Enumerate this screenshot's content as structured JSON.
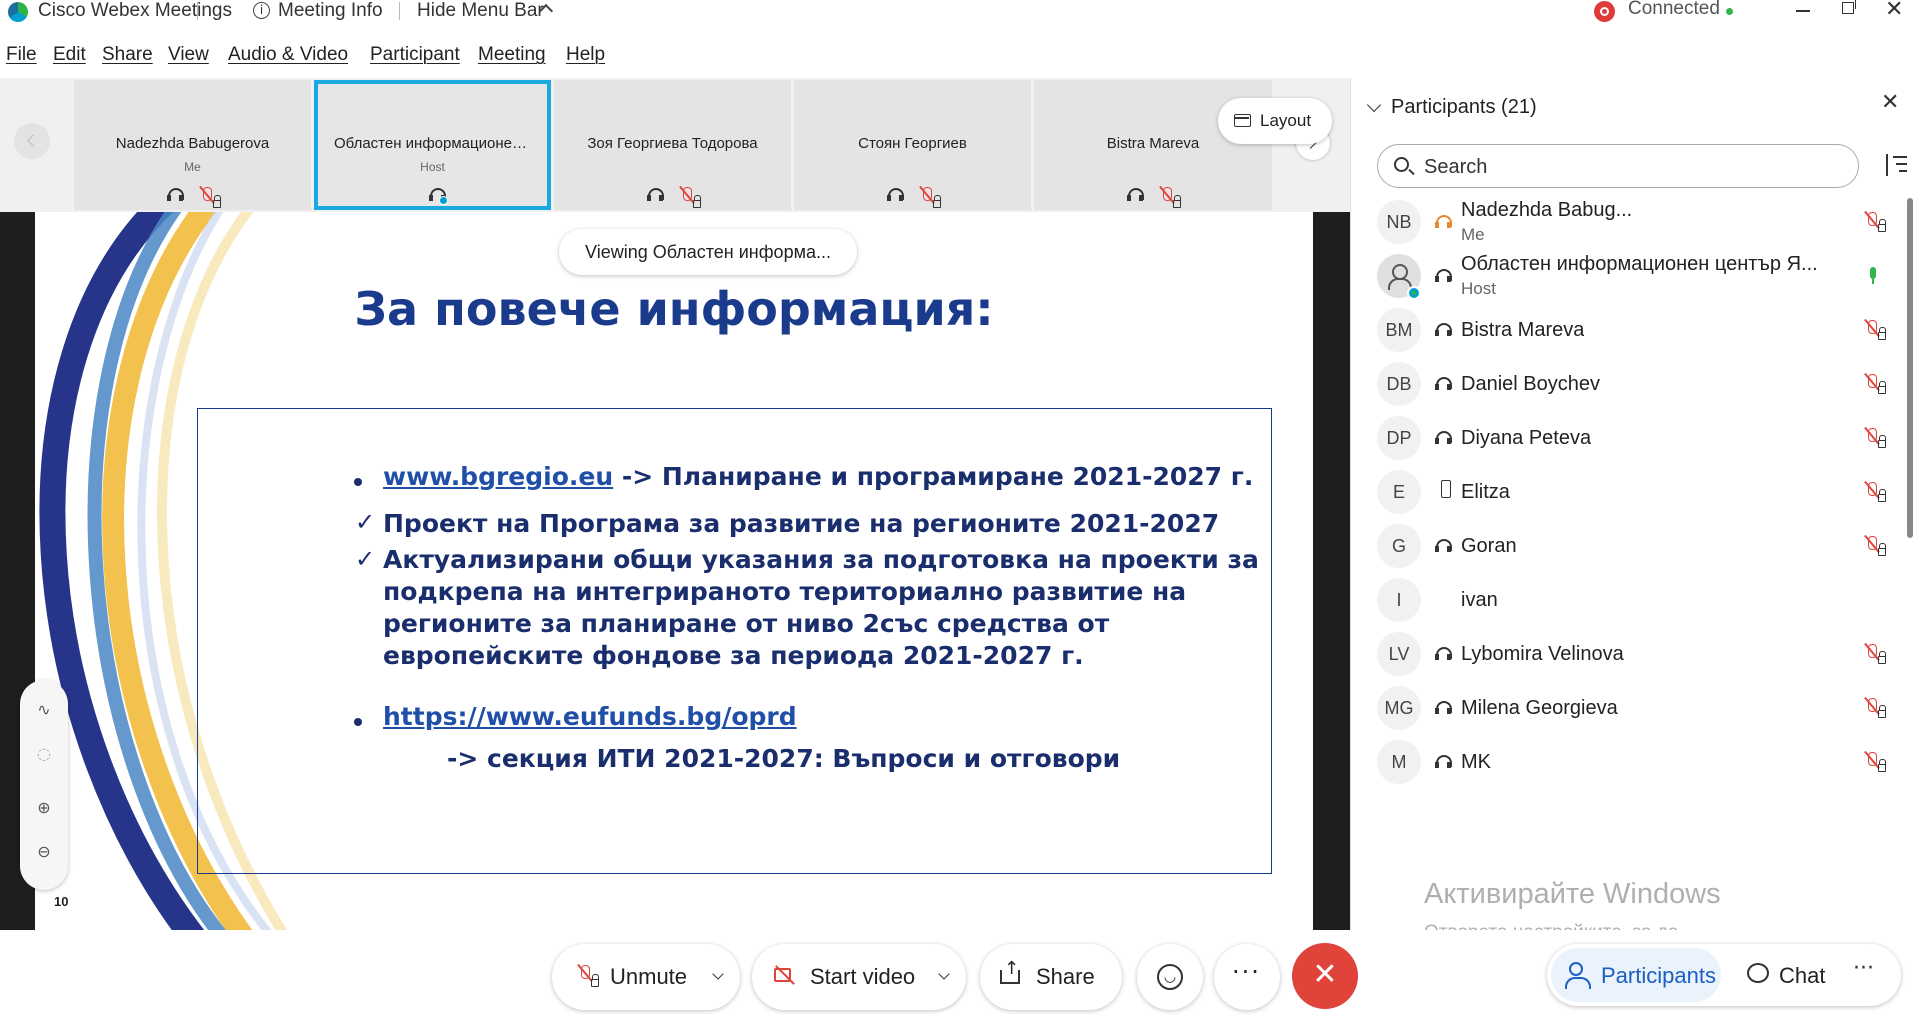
{
  "titlebar": {
    "app_name": "Cisco Webex Meetings",
    "meeting_info": "Meeting Info",
    "hide_menu_bar": "Hide Menu Bar",
    "connection_status": "Connected"
  },
  "menu": [
    "File",
    "Edit",
    "Share",
    "View",
    "Audio & Video",
    "Participant",
    "Meeting",
    "Help"
  ],
  "filmstrip": {
    "tiles": [
      {
        "name": "Nadezhda Babugerova",
        "role": "Me"
      },
      {
        "name": "Областен информационен...",
        "role": "Host"
      },
      {
        "name": "Зоя Георгиева Тодорова",
        "role": ""
      },
      {
        "name": "Стоян Георгиев",
        "role": ""
      },
      {
        "name": "Bistra Mareva",
        "role": ""
      }
    ],
    "layout_label": "Layout"
  },
  "share": {
    "viewing_label": "Viewing Областен информа...",
    "slide": {
      "title": "За повече информация:",
      "link1": "www.bgregio.eu",
      "link1_after": " -> Планиране и програмиране 2021-2027 г.",
      "check1": "Проект на Програма за развитие на регионите 2021-2027",
      "check2_lines": [
        "Актуализирани общи указания за подготовка на проекти за",
        "подкрепа на интегрираното териториално развитие на",
        "регионите за планиране от ниво 2със средства от",
        "европейските фондове за периода 2021-2027 г."
      ],
      "link2": "https://www.eufunds.bg/oprd",
      "link2_after": "-> секция ИТИ 2021-2027: Въпроси и отговори",
      "page_number": "10"
    }
  },
  "participants": {
    "title": "Participants (21)",
    "search_placeholder": "Search",
    "list": [
      {
        "initials": "NB",
        "name": "Nadezhda Babug...",
        "role": "Me"
      },
      {
        "initials": "",
        "name": "Областен информационен център Я...",
        "role": "Host"
      },
      {
        "initials": "BM",
        "name": "Bistra Mareva",
        "role": ""
      },
      {
        "initials": "DB",
        "name": "Daniel Boychev",
        "role": ""
      },
      {
        "initials": "DP",
        "name": "Diyana Peteva",
        "role": ""
      },
      {
        "initials": "E",
        "name": "Elitza",
        "role": ""
      },
      {
        "initials": "G",
        "name": "Goran",
        "role": ""
      },
      {
        "initials": "I",
        "name": "ivan",
        "role": ""
      },
      {
        "initials": "LV",
        "name": "Lybomira Velinova",
        "role": ""
      },
      {
        "initials": "MG",
        "name": "Milena Georgieva",
        "role": ""
      },
      {
        "initials": "M",
        "name": "MK",
        "role": ""
      }
    ]
  },
  "watermark": {
    "line1": "Активирайте Windows",
    "line2": "Отворете настройките, за да активирате Windows."
  },
  "controls": {
    "unmute": "Unmute",
    "start_video": "Start video",
    "share": "Share",
    "more": "···",
    "end": "✕",
    "participants_tab": "Participants",
    "chat_tab": "Chat"
  },
  "colors": {
    "accent": "#1c5fc2",
    "active_speaker": "#1aa9e0",
    "end_red": "#e0433a",
    "slide_title": "#1a3a8c"
  }
}
